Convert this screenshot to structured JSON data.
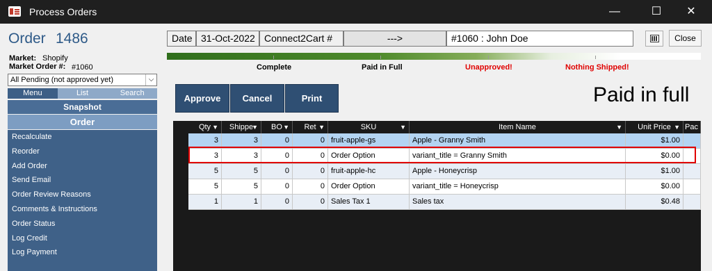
{
  "window": {
    "title": "Process Orders",
    "minimize": "—",
    "maximize": "☐",
    "close": "✕"
  },
  "order": {
    "label": "Order",
    "number": "1486"
  },
  "market": {
    "label": "Market:",
    "value": "Shopify",
    "order_label": "Market Order #:",
    "order_value": "#1060"
  },
  "status": {
    "selected": "All Pending (not approved yet)"
  },
  "tabs": [
    "Menu",
    "List",
    "Search"
  ],
  "snapshot": "Snapshot",
  "section": "Order",
  "menu": [
    "Recalculate",
    "Reorder",
    "Add Order",
    "Send Email",
    "Order Review Reasons",
    "Comments & Instructions",
    "Order Status",
    "Log Credit",
    "Log Payment"
  ],
  "header": {
    "date_label": "Date",
    "date_value": "31-Oct-2022",
    "connect_label": "Connect2Cart #",
    "arrow": "--->",
    "customer": "#1060 : John Doe",
    "close": "Close"
  },
  "progress": {
    "steps": [
      {
        "label": "Complete",
        "color": "#000000"
      },
      {
        "label": "Paid in Full",
        "color": "#000000"
      },
      {
        "label": "Unapproved!",
        "color": "#e00000"
      },
      {
        "label": "Nothing Shipped!",
        "color": "#e00000"
      }
    ]
  },
  "actions": {
    "approve": "Approve",
    "cancel": "Cancel",
    "print": "Print"
  },
  "paid_status": "Paid in full",
  "grid": {
    "columns": [
      "Qty",
      "Shippe",
      "BO",
      "Ret",
      "SKU",
      "Item Name",
      "Unit Price",
      "Pac"
    ],
    "rows": [
      {
        "qty": "3",
        "shipped": "3",
        "bo": "0",
        "ret": "0",
        "sku": "fruit-apple-gs",
        "name": "Apple - Granny Smith",
        "price": "$1.00"
      },
      {
        "qty": "3",
        "shipped": "3",
        "bo": "0",
        "ret": "0",
        "sku": "Order Option",
        "name": "variant_title = Granny Smith",
        "price": "$0.00"
      },
      {
        "qty": "5",
        "shipped": "5",
        "bo": "0",
        "ret": "0",
        "sku": "fruit-apple-hc",
        "name": "Apple - Honeycrisp",
        "price": "$1.00"
      },
      {
        "qty": "5",
        "shipped": "5",
        "bo": "0",
        "ret": "0",
        "sku": "Order Option",
        "name": "variant_title = Honeycrisp",
        "price": "$0.00"
      },
      {
        "qty": "1",
        "shipped": "1",
        "bo": "0",
        "ret": "0",
        "sku": "Sales Tax 1",
        "name": "Sales tax",
        "price": "$0.48"
      }
    ]
  }
}
